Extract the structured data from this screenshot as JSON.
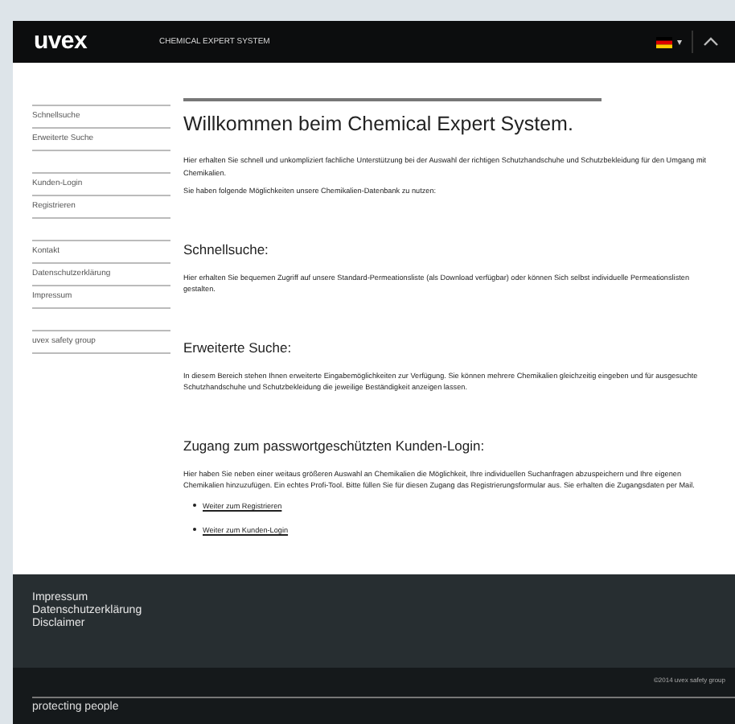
{
  "header": {
    "logo": "uvex",
    "title": "CHEMICAL EXPERT SYSTEM",
    "language_caret": "▾"
  },
  "sidebar": {
    "groups": [
      {
        "items": [
          {
            "label": "Schnellsuche"
          },
          {
            "label": "Erweiterte Suche"
          }
        ]
      },
      {
        "items": [
          {
            "label": "Kunden-Login"
          },
          {
            "label": "Registrieren"
          }
        ]
      },
      {
        "items": [
          {
            "label": "Kontakt"
          },
          {
            "label": "Datenschutzerklärung"
          },
          {
            "label": "Impressum"
          }
        ]
      },
      {
        "items": [
          {
            "label": "uvex safety group"
          }
        ]
      }
    ]
  },
  "main": {
    "heading": "Willkommen beim Chemical Expert System.",
    "intro": [
      "Hier erhalten Sie schnell und unkompliziert fachliche Unterstützung bei der Auswahl der richtigen Schutzhandschuhe und Schutzbekleidung für den Umgang mit Chemikalien.",
      "Sie haben folgende Möglichkeiten unsere Chemikalien-Datenbank zu nutzen:"
    ],
    "sections": [
      {
        "heading": "Schnellsuche:",
        "text": "Hier erhalten Sie bequemen Zugriff auf unsere Standard-Permeationsliste (als Download verfügbar) oder können Sich selbst individuelle Permeationslisten gestalten."
      },
      {
        "heading": "Erweiterte Suche:",
        "text": "In diesem Bereich stehen Ihnen erweiterte Eingabemöglichkeiten zur Verfügung. Sie können mehrere Chemikalien gleichzeitig eingeben und für ausgesuchte Schutzhandschuhe und Schutzbekleidung die jeweilige Beständigkeit anzeigen lassen."
      },
      {
        "heading": "Zugang zum passwortgeschützten Kunden-Login:",
        "text": "Hier haben Sie neben einer weitaus größeren Auswahl an Chemikalien die Möglichkeit, Ihre individuellen Suchanfragen abzuspeichern und Ihre eigenen Chemikalien hinzuzufügen. Ein echtes Profi-Tool. Bitte füllen Sie für diesen Zugang das Registrierungsformular aus. Sie erhalten die Zugangsdaten per Mail.",
        "links": [
          "Weiter zum Registrieren",
          "Weiter zum Kunden-Login"
        ]
      }
    ]
  },
  "footer": {
    "links": [
      "Impressum",
      "Datenschutzerklärung",
      "Disclaimer"
    ],
    "copyright": "©2014 uvex safety group",
    "slogan": "protecting people"
  }
}
